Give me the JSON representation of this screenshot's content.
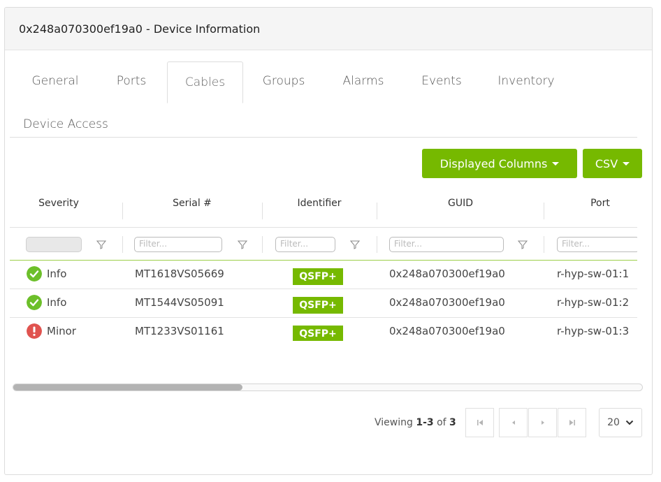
{
  "header": {
    "title": "0x248a070300ef19a0 - Device Information"
  },
  "tabs": [
    {
      "label": "General"
    },
    {
      "label": "Ports"
    },
    {
      "label": "Cables"
    },
    {
      "label": "Groups"
    },
    {
      "label": "Alarms"
    },
    {
      "label": "Events"
    },
    {
      "label": "Inventory"
    },
    {
      "label": "Device Access"
    }
  ],
  "active_tab": "Cables",
  "toolbar": {
    "columns_label": "Displayed Columns",
    "csv_label": "CSV"
  },
  "table": {
    "columns": [
      "Severity",
      "Serial #",
      "Identifier",
      "GUID",
      "Port"
    ],
    "filter_placeholder": "Filter...",
    "rows": [
      {
        "severity": "Info",
        "serial": "MT1618VS05669",
        "identifier": "QSFP+",
        "guid": "0x248a070300ef19a0",
        "port": "r-hyp-sw-01:1"
      },
      {
        "severity": "Info",
        "serial": "MT1544VS05091",
        "identifier": "QSFP+",
        "guid": "0x248a070300ef19a0",
        "port": "r-hyp-sw-01:2"
      },
      {
        "severity": "Minor",
        "serial": "MT1233VS01161",
        "identifier": "QSFP+",
        "guid": "0x248a070300ef19a0",
        "port": "r-hyp-sw-01:3"
      }
    ]
  },
  "pager": {
    "viewing_prefix": "Viewing ",
    "range": "1-3",
    "of_label": " of ",
    "total": "3",
    "page_size": "20"
  },
  "colors": {
    "accent": "#76b900",
    "info": "#6cbf2a",
    "minor": "#e0534f"
  },
  "icons": {
    "first": "first-page-icon",
    "prev": "prev-page-icon",
    "next": "next-page-icon",
    "last": "last-page-icon",
    "filter": "funnel-icon",
    "info": "check-circle-icon",
    "minor": "exclamation-circle-icon"
  }
}
